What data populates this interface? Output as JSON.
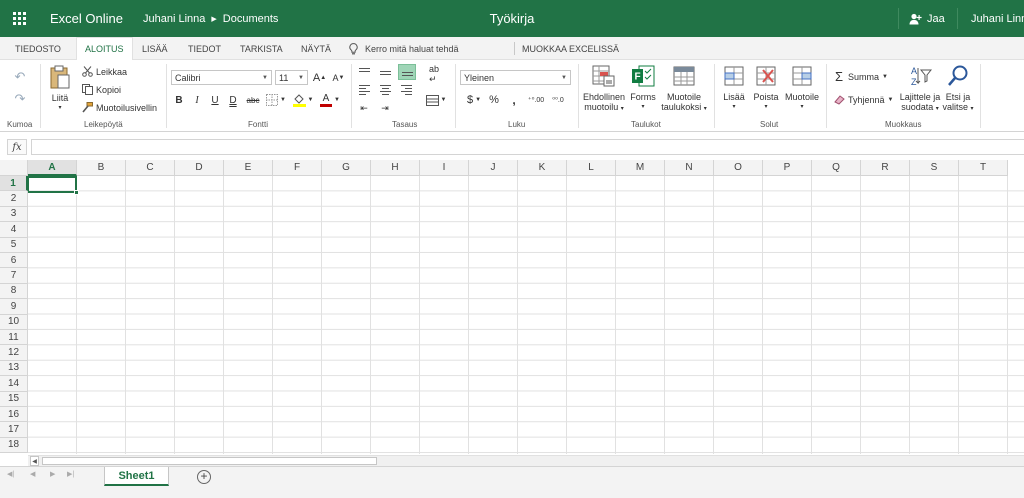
{
  "titlebar": {
    "app_name": "Excel Online",
    "breadcrumb_user": "Juhani Linna",
    "breadcrumb_folder": "Documents",
    "doc_title": "Työkirja",
    "share_label": "Jaa",
    "user_name": "Juhani Linn"
  },
  "tabs": {
    "file": "TIEDOSTO",
    "home": "ALOITUS",
    "insert": "LISÄÄ",
    "data": "TIEDOT",
    "review": "TARKISTA",
    "view": "NÄYTÄ",
    "tell_me": "Kerro mitä haluat tehdä",
    "edit_in_excel": "MUOKKAA EXCELISSÄ"
  },
  "ribbon": {
    "undo_group": "Kumoa",
    "clipboard": {
      "group": "Leikepöytä",
      "paste": "Liitä",
      "cut": "Leikkaa",
      "copy": "Kopioi",
      "format_painter": "Muotoilusivellin"
    },
    "font": {
      "group": "Fontti",
      "name": "Calibri",
      "size": "11",
      "bold": "B",
      "italic": "I",
      "underline": "U",
      "double_underline": "D",
      "strike": "abc",
      "grow": "A",
      "shrink": "A",
      "color_letter": "A"
    },
    "alignment": {
      "group": "Tasaus"
    },
    "number": {
      "group": "Luku",
      "format": "Yleinen",
      "currency": "$",
      "percent": "%",
      "comma": ",",
      "inc_decimal": "⁺⁰.00",
      "dec_decimal": "⁰⁰.0"
    },
    "tables": {
      "group": "Taulukot",
      "conditional_1": "Ehdollinen",
      "conditional_2": "muotoilu",
      "forms": "Forms",
      "format_table_1": "Muotoile",
      "format_table_2": "taulukoksi"
    },
    "cells": {
      "group": "Solut",
      "insert": "Lisää",
      "delete": "Poista",
      "format": "Muotoile"
    },
    "editing": {
      "group": "Muokkaus",
      "sum": "Summa",
      "clear": "Tyhjennä",
      "sort_1": "Lajittele ja",
      "sort_2": "suodata",
      "find_1": "Etsi ja",
      "find_2": "valitse"
    }
  },
  "formula_bar": {
    "fx_label": "fx",
    "value": ""
  },
  "grid": {
    "columns": [
      "A",
      "B",
      "C",
      "D",
      "E",
      "F",
      "G",
      "H",
      "I",
      "J",
      "K",
      "L",
      "M",
      "N",
      "O",
      "P",
      "Q",
      "R",
      "S",
      "T"
    ],
    "rows": [
      "1",
      "2",
      "3",
      "4",
      "5",
      "6",
      "7",
      "8",
      "9",
      "10",
      "11",
      "12",
      "13",
      "14",
      "15",
      "16",
      "17",
      "18"
    ],
    "selected_cell": "A1"
  },
  "sheets": {
    "active": "Sheet1",
    "add_label": "+"
  },
  "colors": {
    "accent": "#217346",
    "ribbon_tab_bg": "#f3f3f3",
    "gridline": "#e1e1e1"
  }
}
